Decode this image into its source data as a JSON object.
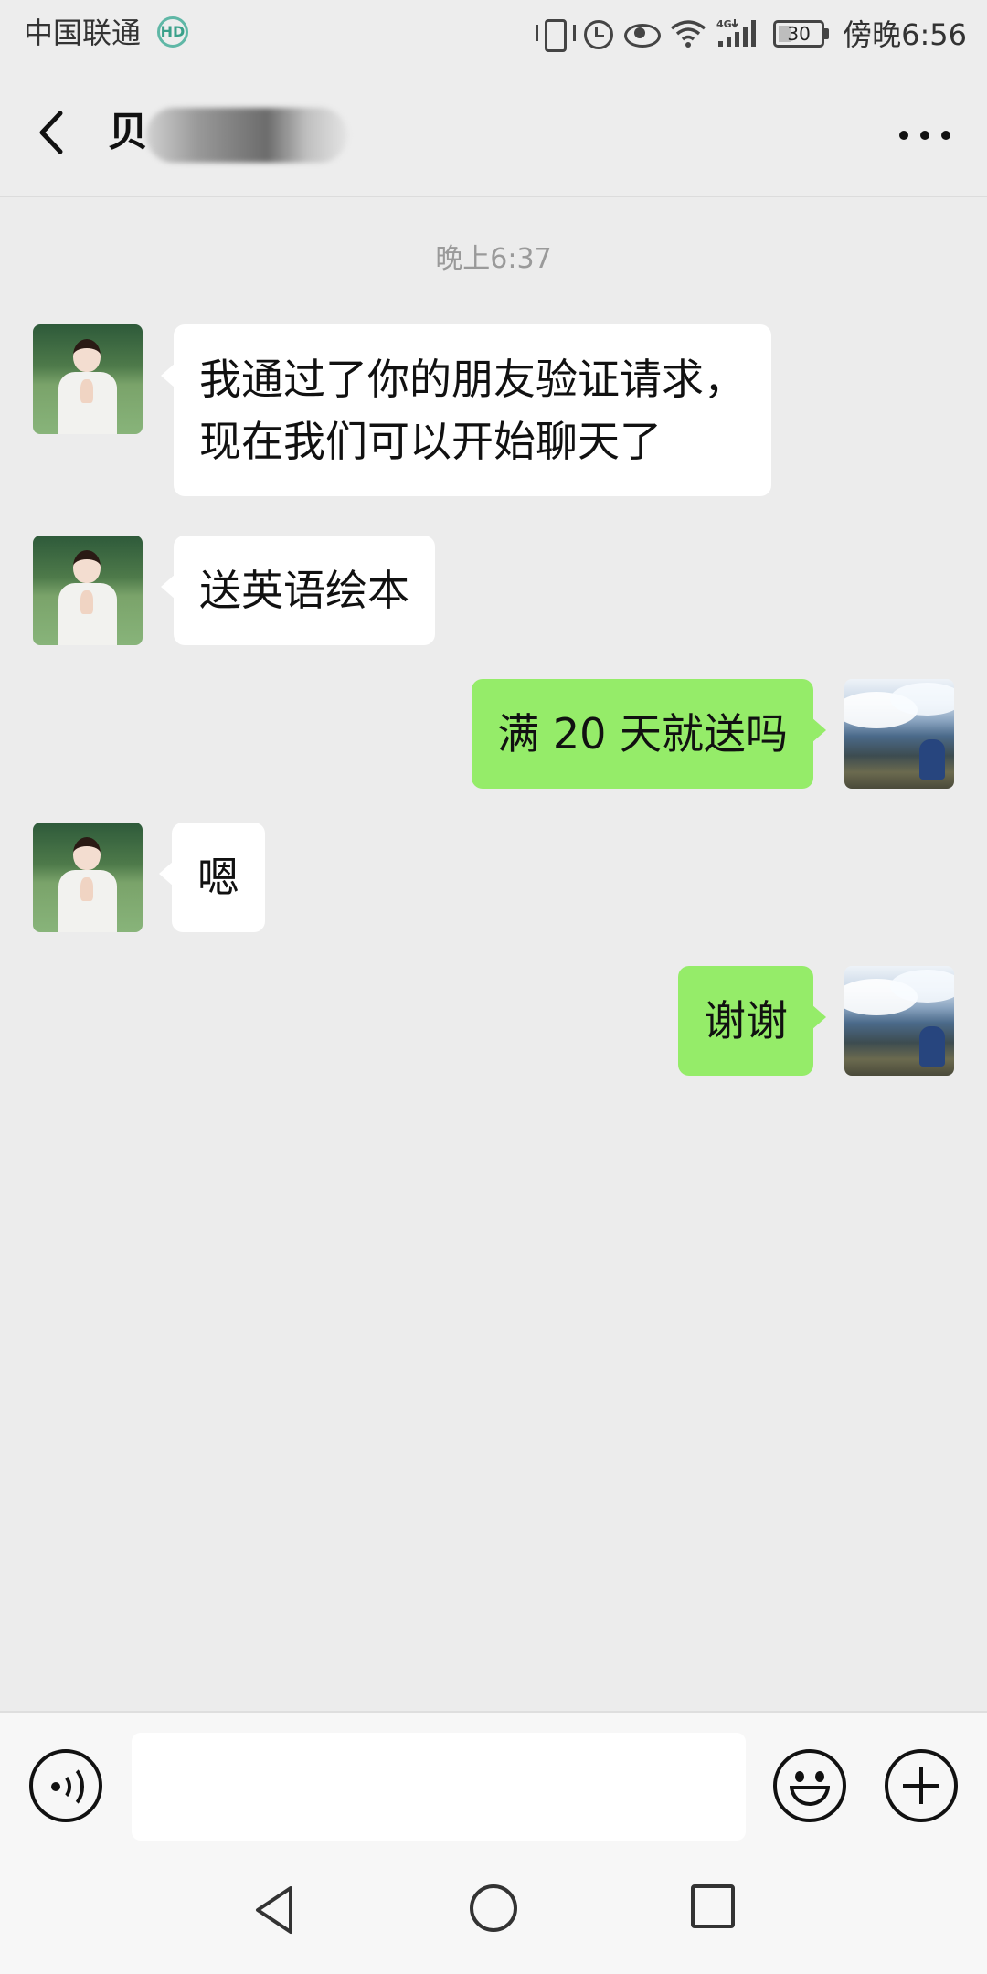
{
  "status_bar": {
    "carrier": "中国联通",
    "battery": "30",
    "battery_level": 0.3,
    "time": "傍晚6:56",
    "icons": [
      "vibrate-icon",
      "alarm-icon",
      "eye-comfort-icon",
      "wifi-icon",
      "signal-4g-icon",
      "battery-icon"
    ]
  },
  "nav": {
    "title": "贝",
    "back_icon": "chevron-left-icon",
    "more_icon": "more-dots-icon"
  },
  "chat": {
    "timestamp": "晚上6:37",
    "messages": [
      {
        "side": "in",
        "lines": [
          "我通过了你的朋友验证请求，",
          "现在我们可以开始聊天了"
        ]
      },
      {
        "side": "in",
        "lines": [
          "送英语绘本"
        ]
      },
      {
        "side": "out",
        "lines": [
          "满 20 天就送吗"
        ]
      },
      {
        "side": "in",
        "lines": [
          "嗯"
        ]
      },
      {
        "side": "out",
        "lines": [
          "谢谢"
        ]
      }
    ]
  },
  "input_bar": {
    "voice_icon": "voice-input-icon",
    "text_value": "",
    "emoji_icon": "emoji-icon",
    "plus_icon": "plus-icon"
  },
  "system_nav": {
    "icons": [
      "back-triangle-icon",
      "home-circle-icon",
      "recent-square-icon"
    ]
  },
  "colors": {
    "background": "#ececec",
    "incoming_bubble": "#ffffff",
    "outgoing_bubble": "#95ec69"
  }
}
